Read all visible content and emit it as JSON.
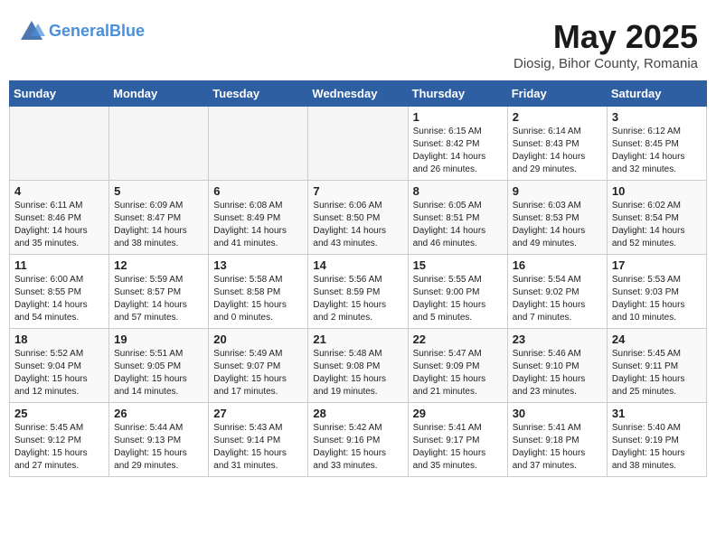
{
  "logo": {
    "line1": "General",
    "line2": "Blue"
  },
  "title": "May 2025",
  "subtitle": "Diosig, Bihor County, Romania",
  "weekdays": [
    "Sunday",
    "Monday",
    "Tuesday",
    "Wednesday",
    "Thursday",
    "Friday",
    "Saturday"
  ],
  "weeks": [
    [
      {
        "day": "",
        "empty": true
      },
      {
        "day": "",
        "empty": true
      },
      {
        "day": "",
        "empty": true
      },
      {
        "day": "",
        "empty": true
      },
      {
        "day": "1",
        "sunrise": "6:15 AM",
        "sunset": "8:42 PM",
        "daylight": "14 hours and 26 minutes."
      },
      {
        "day": "2",
        "sunrise": "6:14 AM",
        "sunset": "8:43 PM",
        "daylight": "14 hours and 29 minutes."
      },
      {
        "day": "3",
        "sunrise": "6:12 AM",
        "sunset": "8:45 PM",
        "daylight": "14 hours and 32 minutes."
      }
    ],
    [
      {
        "day": "4",
        "sunrise": "6:11 AM",
        "sunset": "8:46 PM",
        "daylight": "14 hours and 35 minutes."
      },
      {
        "day": "5",
        "sunrise": "6:09 AM",
        "sunset": "8:47 PM",
        "daylight": "14 hours and 38 minutes."
      },
      {
        "day": "6",
        "sunrise": "6:08 AM",
        "sunset": "8:49 PM",
        "daylight": "14 hours and 41 minutes."
      },
      {
        "day": "7",
        "sunrise": "6:06 AM",
        "sunset": "8:50 PM",
        "daylight": "14 hours and 43 minutes."
      },
      {
        "day": "8",
        "sunrise": "6:05 AM",
        "sunset": "8:51 PM",
        "daylight": "14 hours and 46 minutes."
      },
      {
        "day": "9",
        "sunrise": "6:03 AM",
        "sunset": "8:53 PM",
        "daylight": "14 hours and 49 minutes."
      },
      {
        "day": "10",
        "sunrise": "6:02 AM",
        "sunset": "8:54 PM",
        "daylight": "14 hours and 52 minutes."
      }
    ],
    [
      {
        "day": "11",
        "sunrise": "6:00 AM",
        "sunset": "8:55 PM",
        "daylight": "14 hours and 54 minutes."
      },
      {
        "day": "12",
        "sunrise": "5:59 AM",
        "sunset": "8:57 PM",
        "daylight": "14 hours and 57 minutes."
      },
      {
        "day": "13",
        "sunrise": "5:58 AM",
        "sunset": "8:58 PM",
        "daylight": "15 hours and 0 minutes."
      },
      {
        "day": "14",
        "sunrise": "5:56 AM",
        "sunset": "8:59 PM",
        "daylight": "15 hours and 2 minutes."
      },
      {
        "day": "15",
        "sunrise": "5:55 AM",
        "sunset": "9:00 PM",
        "daylight": "15 hours and 5 minutes."
      },
      {
        "day": "16",
        "sunrise": "5:54 AM",
        "sunset": "9:02 PM",
        "daylight": "15 hours and 7 minutes."
      },
      {
        "day": "17",
        "sunrise": "5:53 AM",
        "sunset": "9:03 PM",
        "daylight": "15 hours and 10 minutes."
      }
    ],
    [
      {
        "day": "18",
        "sunrise": "5:52 AM",
        "sunset": "9:04 PM",
        "daylight": "15 hours and 12 minutes."
      },
      {
        "day": "19",
        "sunrise": "5:51 AM",
        "sunset": "9:05 PM",
        "daylight": "15 hours and 14 minutes."
      },
      {
        "day": "20",
        "sunrise": "5:49 AM",
        "sunset": "9:07 PM",
        "daylight": "15 hours and 17 minutes."
      },
      {
        "day": "21",
        "sunrise": "5:48 AM",
        "sunset": "9:08 PM",
        "daylight": "15 hours and 19 minutes."
      },
      {
        "day": "22",
        "sunrise": "5:47 AM",
        "sunset": "9:09 PM",
        "daylight": "15 hours and 21 minutes."
      },
      {
        "day": "23",
        "sunrise": "5:46 AM",
        "sunset": "9:10 PM",
        "daylight": "15 hours and 23 minutes."
      },
      {
        "day": "24",
        "sunrise": "5:45 AM",
        "sunset": "9:11 PM",
        "daylight": "15 hours and 25 minutes."
      }
    ],
    [
      {
        "day": "25",
        "sunrise": "5:45 AM",
        "sunset": "9:12 PM",
        "daylight": "15 hours and 27 minutes."
      },
      {
        "day": "26",
        "sunrise": "5:44 AM",
        "sunset": "9:13 PM",
        "daylight": "15 hours and 29 minutes."
      },
      {
        "day": "27",
        "sunrise": "5:43 AM",
        "sunset": "9:14 PM",
        "daylight": "15 hours and 31 minutes."
      },
      {
        "day": "28",
        "sunrise": "5:42 AM",
        "sunset": "9:16 PM",
        "daylight": "15 hours and 33 minutes."
      },
      {
        "day": "29",
        "sunrise": "5:41 AM",
        "sunset": "9:17 PM",
        "daylight": "15 hours and 35 minutes."
      },
      {
        "day": "30",
        "sunrise": "5:41 AM",
        "sunset": "9:18 PM",
        "daylight": "15 hours and 37 minutes."
      },
      {
        "day": "31",
        "sunrise": "5:40 AM",
        "sunset": "9:19 PM",
        "daylight": "15 hours and 38 minutes."
      }
    ]
  ]
}
